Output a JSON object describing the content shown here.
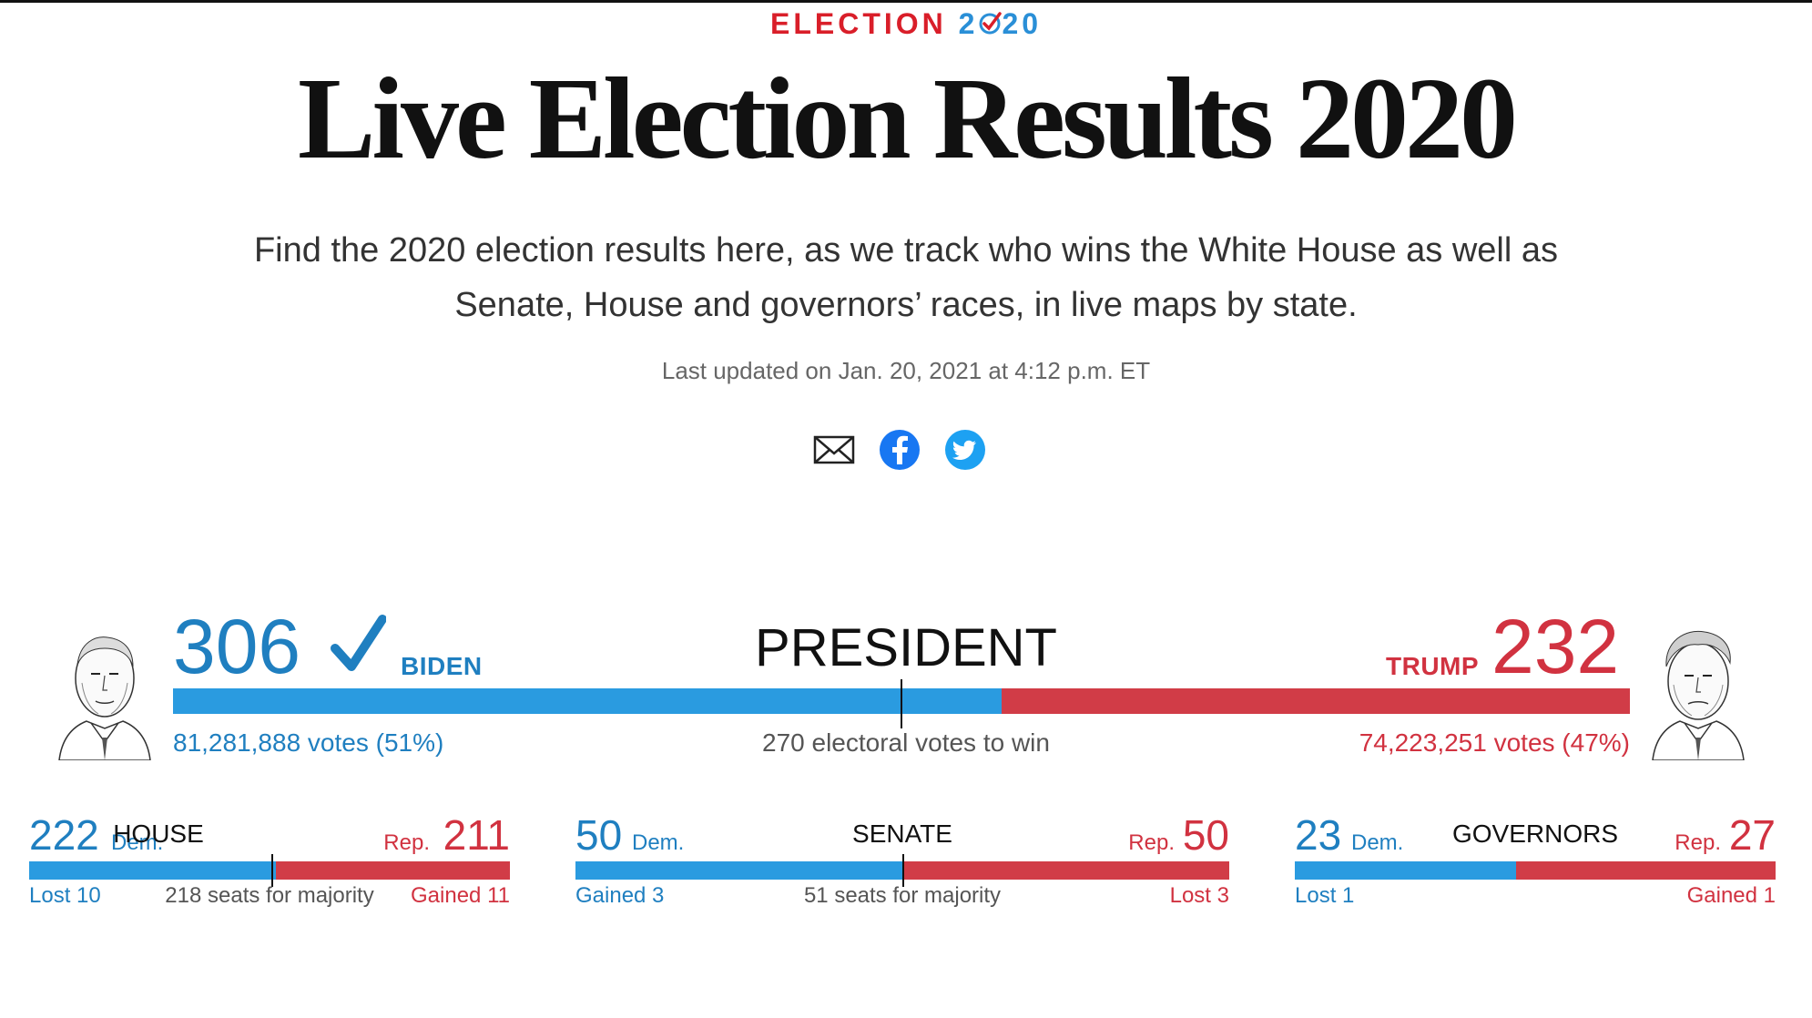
{
  "header": {
    "kicker_word": "ELECTION",
    "kicker_year_a": "2",
    "kicker_year_b": "20",
    "title": "Live Election Results 2020",
    "dek": "Find the 2020 election results here, as we track who wins the White House as well as Senate, House and governors’ races, in live maps by state.",
    "updated": "Last updated on Jan. 20, 2021 at 4:12 p.m. ET"
  },
  "share": {
    "email_icon": "mail-icon",
    "facebook_icon": "facebook-icon",
    "twitter_icon": "twitter-icon"
  },
  "colors": {
    "dem": "#2a9be0",
    "rep": "#d13c47",
    "dem_text": "#1f7fc0",
    "rep_text": "#d13240"
  },
  "president": {
    "title": "PRESIDENT",
    "dem": {
      "electoral": "306",
      "name": "BIDEN",
      "votes": "81,281,888 votes (51%)",
      "winner_check": "✓"
    },
    "rep": {
      "electoral": "232",
      "name": "TRUMP",
      "votes": "74,223,251 votes (47%)"
    },
    "win_label": "270 electoral votes to win",
    "dem_share": 0.5688,
    "majority_share": 0.5
  },
  "chambers": [
    {
      "title": "HOUSE",
      "dem": "222",
      "dem_label": "Dem.",
      "rep": "211",
      "rep_label": "Rep.",
      "dem_change": "Lost 10",
      "rep_change": "Gained 11",
      "mid_label": "218 seats for majority",
      "dem_share": 0.513,
      "majority_share": 0.503
    },
    {
      "title": "SENATE",
      "dem": "50",
      "dem_label": "Dem.",
      "rep": "50",
      "rep_label": "Rep.",
      "dem_change": "Gained 3",
      "rep_change": "Lost 3",
      "mid_label": "51 seats for majority",
      "dem_share": 0.5,
      "majority_share": 0.5
    },
    {
      "title": "GOVERNORS",
      "dem": "23",
      "dem_label": "Dem.",
      "rep": "27",
      "rep_label": "Rep.",
      "dem_change": "Lost 1",
      "rep_change": "Gained 1",
      "mid_label": "",
      "dem_share": 0.46
    }
  ]
}
